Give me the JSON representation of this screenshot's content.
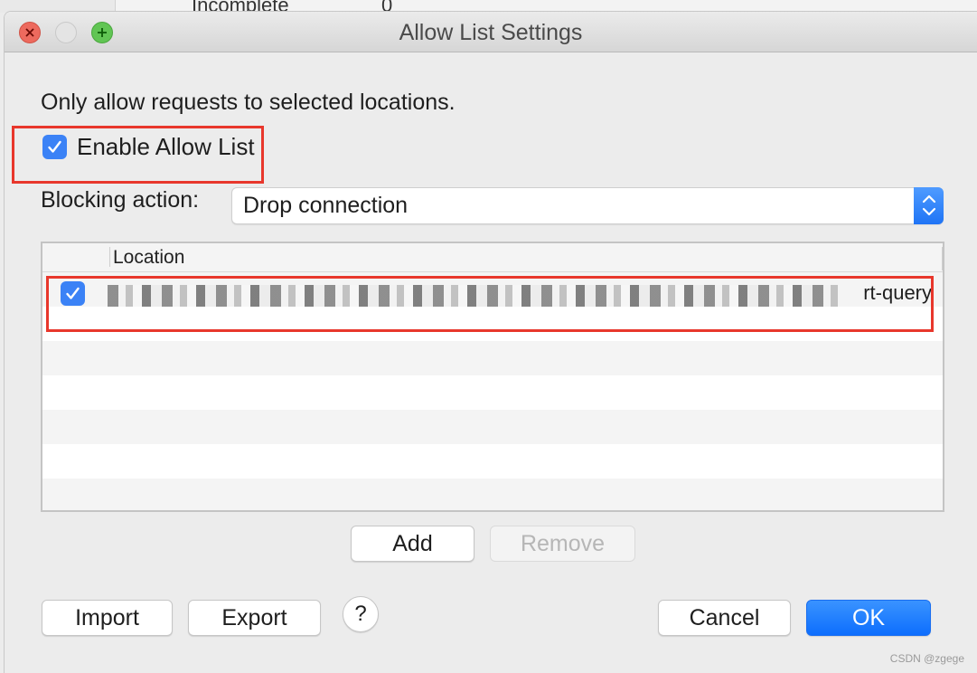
{
  "background_app": {
    "partial_text_left": "Incomplete",
    "partial_text_right": "0"
  },
  "window": {
    "title": "Allow List Settings",
    "controls": [
      "close",
      "minimize",
      "zoom"
    ]
  },
  "intro_text": "Only allow requests to selected locations.",
  "enable_allow_list": {
    "label": "Enable Allow List",
    "checked": true
  },
  "blocking_action": {
    "label": "Blocking action:",
    "selected": "Drop connection"
  },
  "locations_table": {
    "columns": [
      "",
      "Location"
    ],
    "rows": [
      {
        "enabled": true,
        "location_suffix": "rt-query",
        "redacted": true
      }
    ],
    "empty_rows": 6
  },
  "list_buttons": {
    "add": "Add",
    "remove": "Remove",
    "remove_disabled": true
  },
  "footer": {
    "import": "Import",
    "export": "Export",
    "help": "?",
    "cancel": "Cancel",
    "ok": "OK"
  },
  "watermark": "CSDN @zgege",
  "colors": {
    "accent": "#1f74f5",
    "highlight_box": "#e8372c",
    "checkbox": "#3b82f6"
  }
}
